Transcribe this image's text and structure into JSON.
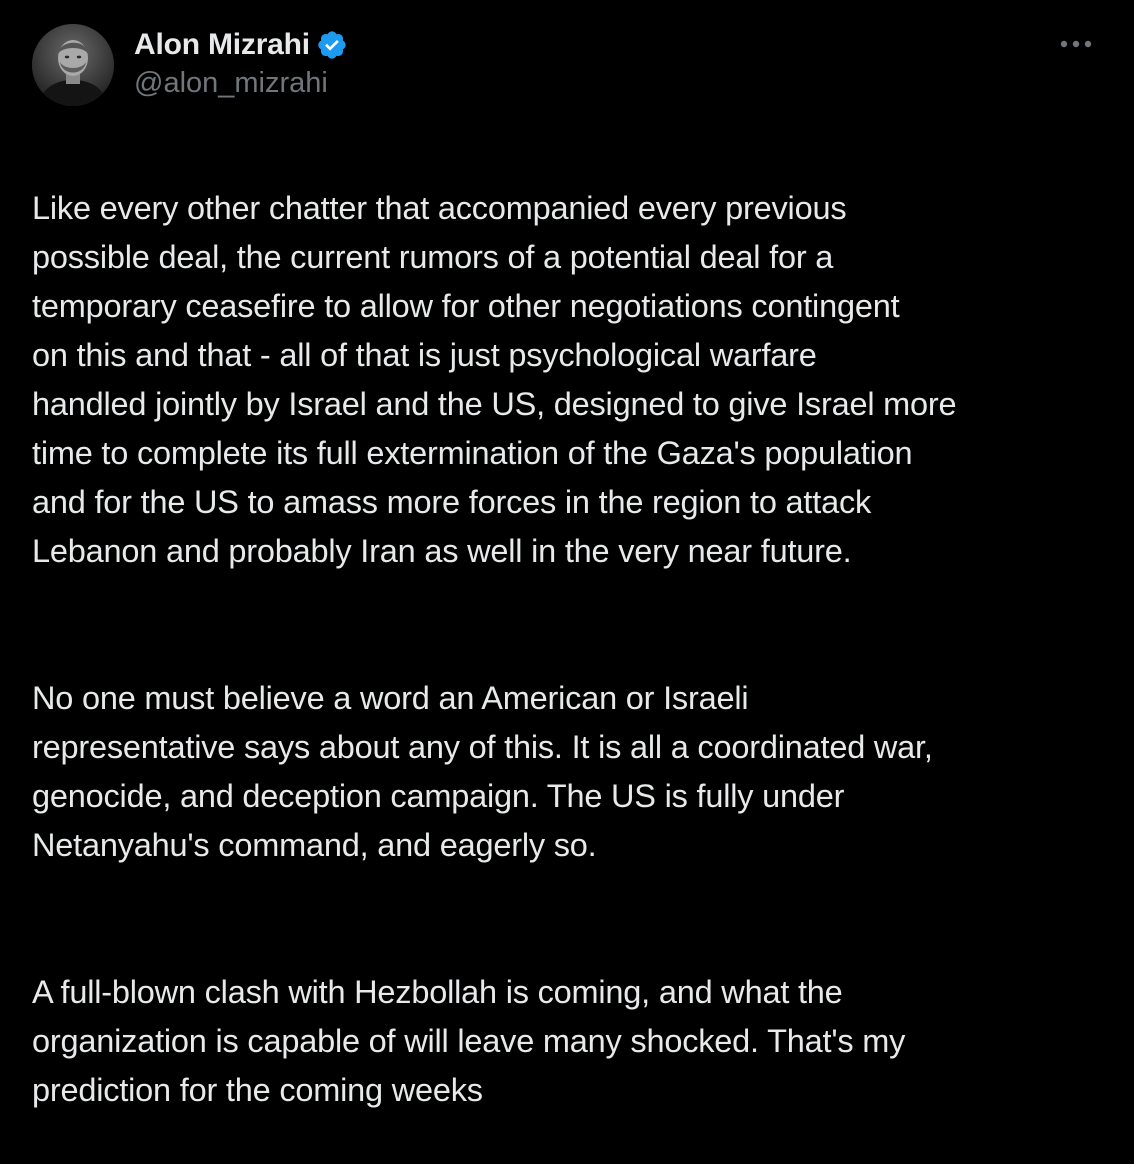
{
  "author": {
    "display_name": "Alon Mizrahi",
    "handle": "@alon_mizrahi",
    "verified_icon": "verified-badge-icon",
    "verified_color": "#1d9bf0"
  },
  "actions": {
    "more_icon": "more-horizontal-icon"
  },
  "tweet": {
    "paragraphs": [
      "Like every other chatter that accompanied every previous\npossible deal, the current rumors of a potential deal for a\ntemporary ceasefire to allow for other negotiations contingent\non this and that -  all of that is just psychological warfare\nhandled jointly by Israel and the US, designed to give Israel more\ntime to complete its full extermination of the Gaza's population\nand for the US to amass more forces in the region to attack\nLebanon and probably Iran as well in the very near future.",
      "No one must believe a word an American or Israeli\nrepresentative says about any of this. It is all a coordinated war,\ngenocide, and deception campaign. The US is fully under\nNetanyahu's command, and eagerly so.",
      "A full-blown clash with Hezbollah is coming, and what the\norganization is capable of will leave many shocked. That's my\nprediction for the coming weeks"
    ]
  },
  "colors": {
    "background": "#000000",
    "text_primary": "#e7e9ea",
    "text_secondary": "#71767b"
  }
}
